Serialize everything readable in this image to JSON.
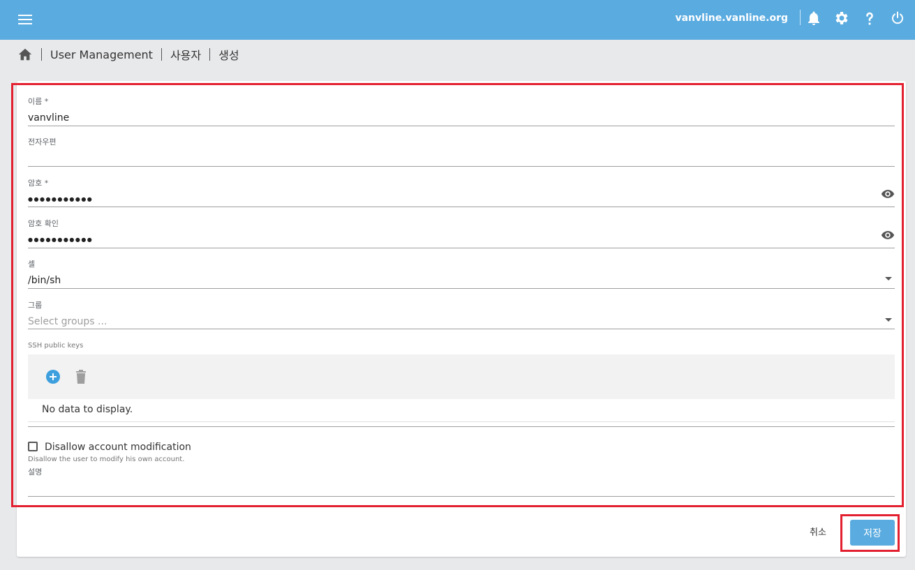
{
  "header": {
    "hostname": "vanvline.vanline.org",
    "icons": [
      "menu-icon",
      "bell-icon",
      "gear-icon",
      "help-icon",
      "power-icon"
    ]
  },
  "breadcrumb": [
    "User Management",
    "사용자",
    "생성"
  ],
  "form": {
    "name": {
      "label": "이름 *",
      "value": "vanvline"
    },
    "email": {
      "label": "전자우편",
      "value": ""
    },
    "password": {
      "label": "암호 *",
      "value": "●●●●●●●●●●●"
    },
    "password_confirm": {
      "label": "암호 확인",
      "value": "●●●●●●●●●●●"
    },
    "shell": {
      "label": "셸",
      "value": "/bin/sh"
    },
    "groups": {
      "label": "그룹",
      "placeholder": "Select groups ..."
    },
    "ssh": {
      "label": "SSH public keys",
      "empty_text": "No data to display."
    },
    "disallow": {
      "label": "Disallow account modification",
      "hint": "Disallow the user to modify his own account.",
      "checked": false
    },
    "description": {
      "label": "설명",
      "value": ""
    }
  },
  "actions": {
    "cancel_label": "취소",
    "save_label": "저장"
  },
  "colors": {
    "accent": "#5aabe0",
    "highlight": "#e32030"
  }
}
